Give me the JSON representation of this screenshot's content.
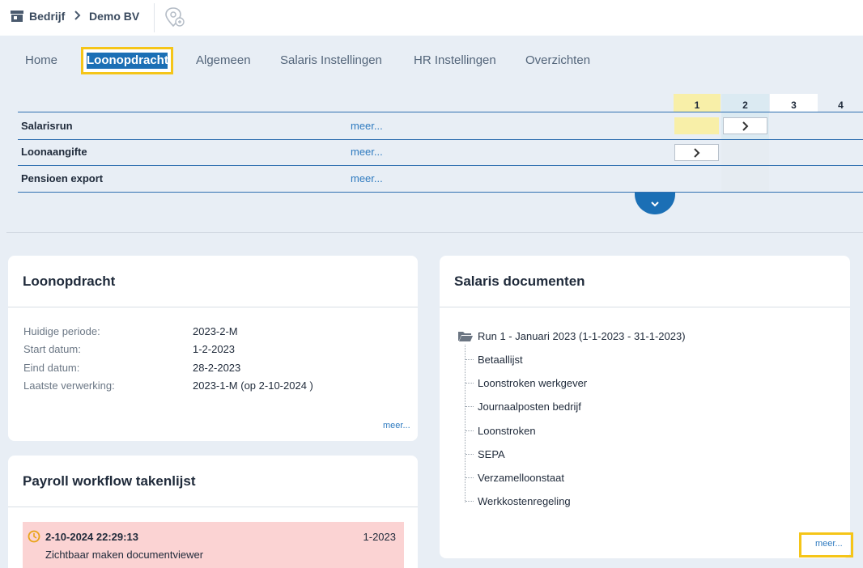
{
  "breadcrumb": {
    "company_label": "Bedrijf",
    "current": "Demo BV"
  },
  "tabs": [
    {
      "label": "Home"
    },
    {
      "label": "Loonopdracht"
    },
    {
      "label": "Algemeen"
    },
    {
      "label": "Salaris Instellingen"
    },
    {
      "label": "HR Instellingen"
    },
    {
      "label": "Overzichten"
    }
  ],
  "workflow": {
    "columns": [
      "1",
      "2",
      "3",
      "4"
    ],
    "rows": [
      {
        "label": "Salarisrun",
        "more": "meer..."
      },
      {
        "label": "Loonaangifte",
        "more": "meer..."
      },
      {
        "label": "Pensioen export",
        "more": "meer..."
      }
    ]
  },
  "loonopdracht": {
    "title": "Loonopdracht",
    "fields": [
      {
        "label": "Huidige periode:",
        "value": "2023-2-M"
      },
      {
        "label": "Start datum:",
        "value": "1-2-2023"
      },
      {
        "label": "Eind datum:",
        "value": "28-2-2023"
      },
      {
        "label": "Laatste verwerking:",
        "value": "2023-1-M (op 2-10-2024 )"
      }
    ],
    "more": "meer..."
  },
  "takenlijst": {
    "title": "Payroll workflow takenlijst",
    "task": {
      "time": "2-10-2024 22:29:13",
      "period": "1-2023",
      "description": "Zichtbaar maken documentviewer"
    }
  },
  "salaris_documenten": {
    "title": "Salaris documenten",
    "root": "Run 1 - Januari 2023 (1-1-2023 - 31-1-2023)",
    "items": [
      "Betaallijst",
      "Loonstroken werkgever",
      "Journaalposten bedrijf",
      "Loonstroken",
      "SEPA",
      "Verzamelloonstaat",
      "Werkkostenregeling"
    ],
    "more": "meer..."
  },
  "colors": {
    "accent": "#1b6fb5",
    "highlight": "#f5c518",
    "col1_bg": "#f8efa8",
    "col2_bg": "#dbeaf2",
    "task_bg": "#fbd3d3"
  }
}
